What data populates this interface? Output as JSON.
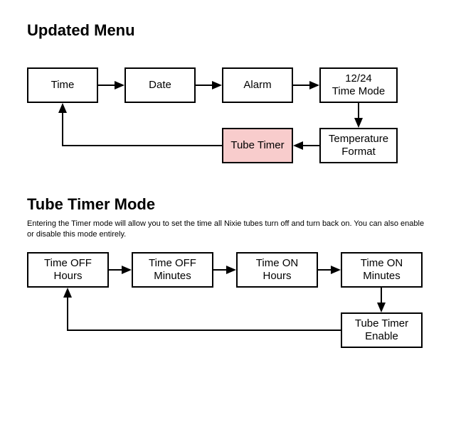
{
  "section1": {
    "title": "Updated Menu",
    "boxes": {
      "time": "Time",
      "date": "Date",
      "alarm": "Alarm",
      "timemode": "12/24\nTime Mode",
      "tempformat": "Temperature\nFormat",
      "tubetimer": "Tube Timer"
    }
  },
  "section2": {
    "title": "Tube Timer Mode",
    "description": "Entering the Timer mode will allow you to set the time all Nixie tubes turn off and turn back on. You can also enable or disable this mode entirely.",
    "boxes": {
      "toff_h": "Time OFF\nHours",
      "toff_m": "Time OFF\nMinutes",
      "ton_h": "Time ON\nHours",
      "ton_m": "Time ON\nMinutes",
      "tt_enable": "Tube Timer\nEnable"
    }
  }
}
